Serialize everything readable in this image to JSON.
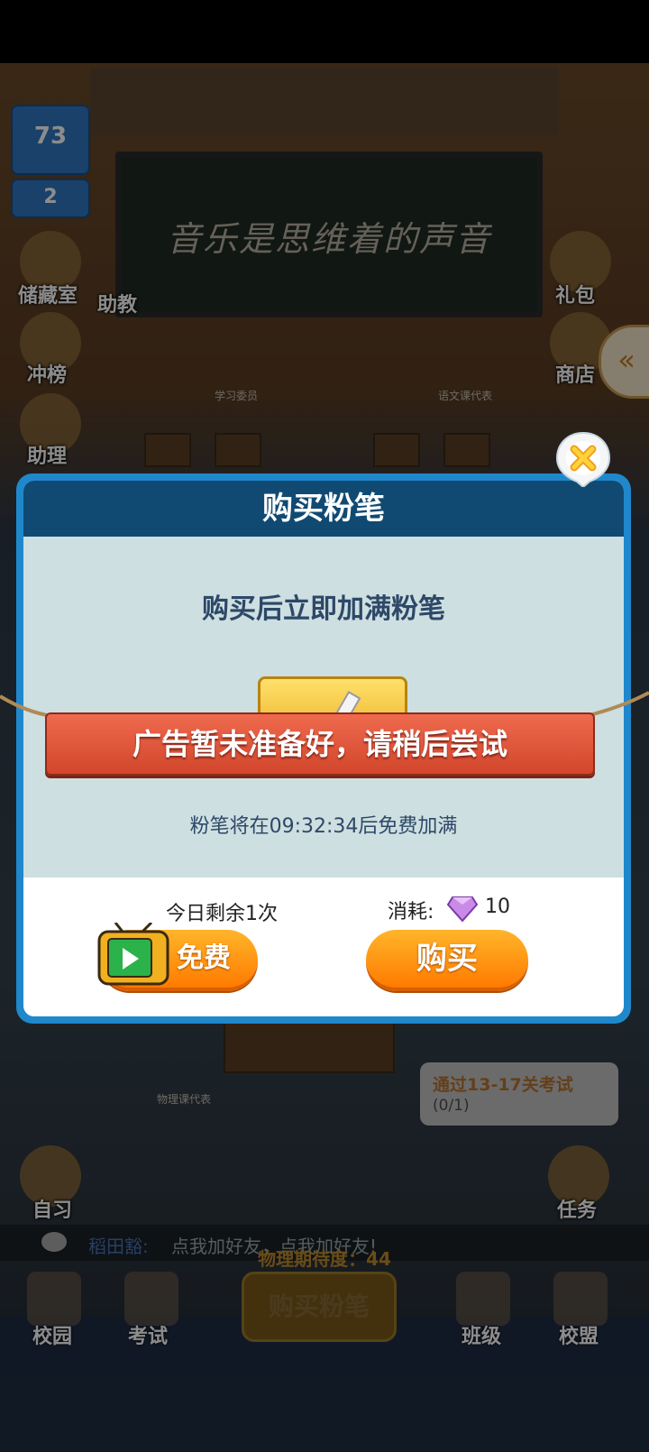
{
  "scene": {
    "board_text": "音乐是思维着的声音",
    "seat_labels": [
      "学习委员",
      "语文课代表",
      "物理课代表"
    ],
    "level_value": "73",
    "rank_value": "2",
    "left_menu": [
      "储藏室",
      "冲榜",
      "助理"
    ],
    "assistant_label": "助教",
    "right_menu": [
      "礼包",
      "商店"
    ],
    "task_bubble_title": "通过13-17关考试",
    "task_bubble_progress": "(0/1)",
    "self_study_label": "自习",
    "task_label": "任务",
    "chat_name": "稻田豁:",
    "chat_message": "点我加好友，点我加好友!",
    "anticipation": "物理期待度：44",
    "center_button": "购买粉笔",
    "bottom_nav": [
      "校园",
      "考试",
      "班级",
      "校盟"
    ]
  },
  "dialog": {
    "title": "购买粉笔",
    "subtitle": "购买后立即加满粉笔",
    "timer_text": "粉笔将在09:32:34后免费加满",
    "free_remaining": "今日剩余1次",
    "free_button": "免费",
    "cost_label": "消耗:",
    "cost_value": "10",
    "buy_button": "购买"
  },
  "ribbon": {
    "text": "广告暂未准备好，请稍后尝试"
  },
  "colors": {
    "dialog_border": "#1f88cc",
    "header": "#104a73",
    "ribbon": "#d9553a",
    "button": "#ff8a00"
  }
}
